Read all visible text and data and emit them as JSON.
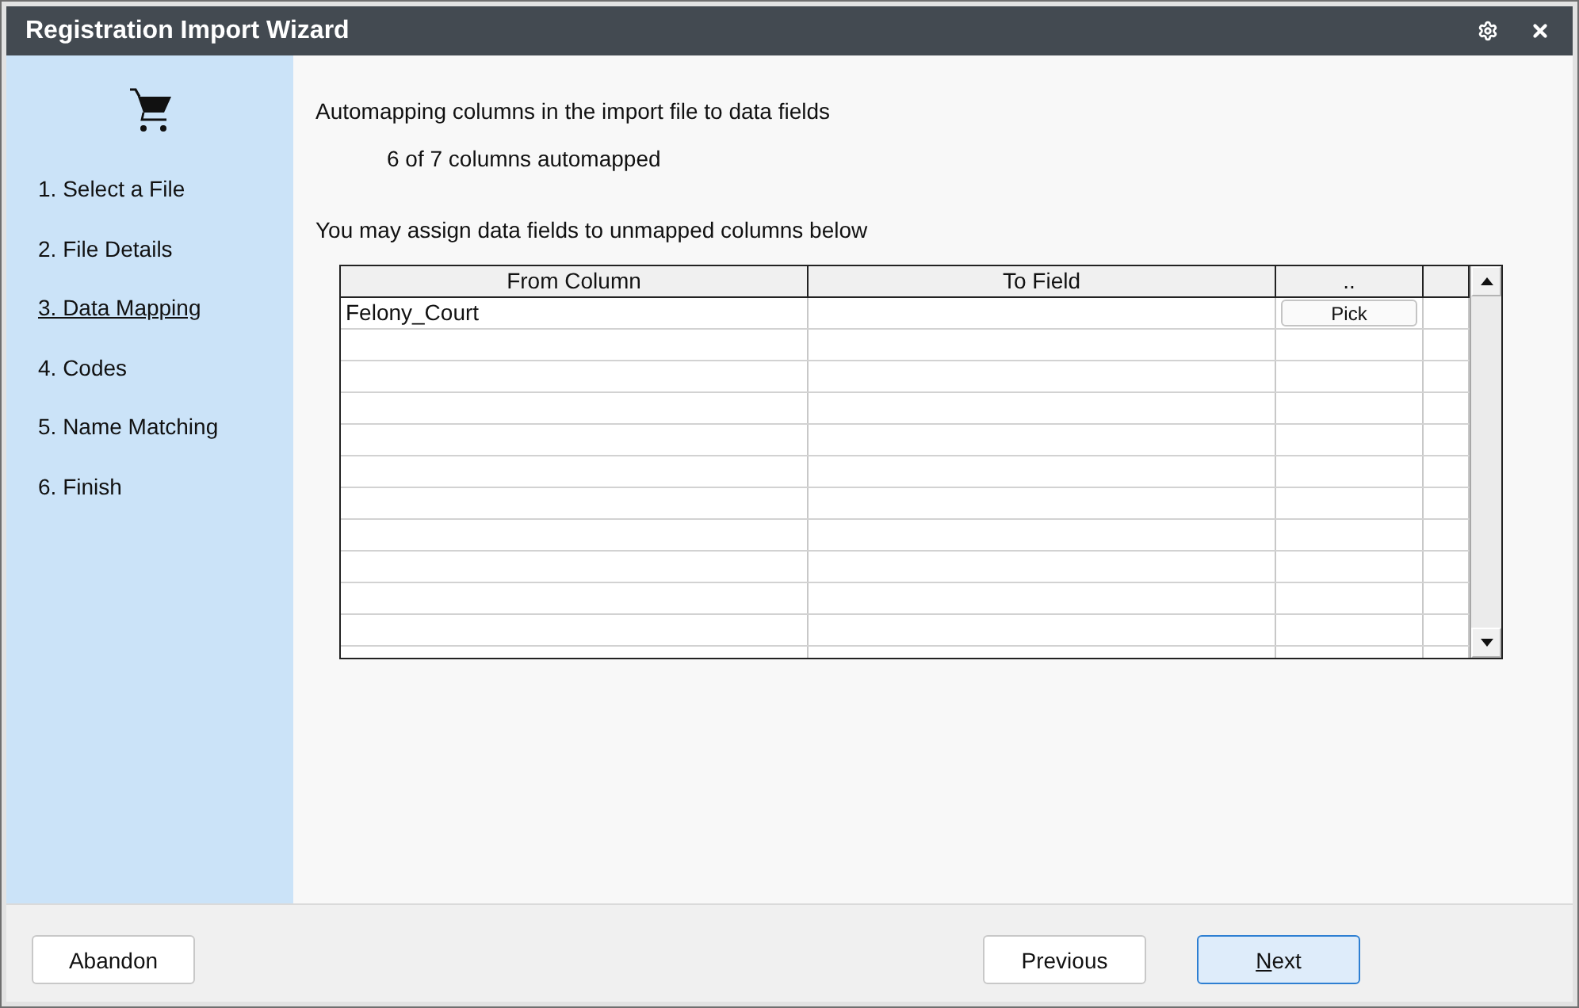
{
  "window": {
    "title": "Registration Import Wizard"
  },
  "sidebar": {
    "steps": [
      {
        "label": "1. Select a File",
        "selected": false
      },
      {
        "label": "2. File Details",
        "selected": false
      },
      {
        "label": "3. Data Mapping",
        "selected": true
      },
      {
        "label": "4. Codes",
        "selected": false
      },
      {
        "label": "5. Name Matching",
        "selected": false
      },
      {
        "label": "6. Finish",
        "selected": false
      }
    ]
  },
  "content": {
    "heading": "Automapping columns in the import file to data fields",
    "summary": "6 of 7 columns automapped",
    "instruction": "You may assign data fields to unmapped columns below"
  },
  "grid": {
    "columns": [
      "From Column",
      "To Field",
      ".."
    ],
    "rows": [
      {
        "from_column": "Felony_Court",
        "pick_button": "Pick"
      }
    ]
  },
  "footer": {
    "buttons": [
      {
        "label": "Abandon",
        "default": false,
        "access_key_underlined": false
      },
      {
        "label": "Previous",
        "default": false,
        "access_key_underlined": false
      },
      {
        "label": "Next",
        "default": true,
        "access_key_underlined": true
      }
    ]
  }
}
